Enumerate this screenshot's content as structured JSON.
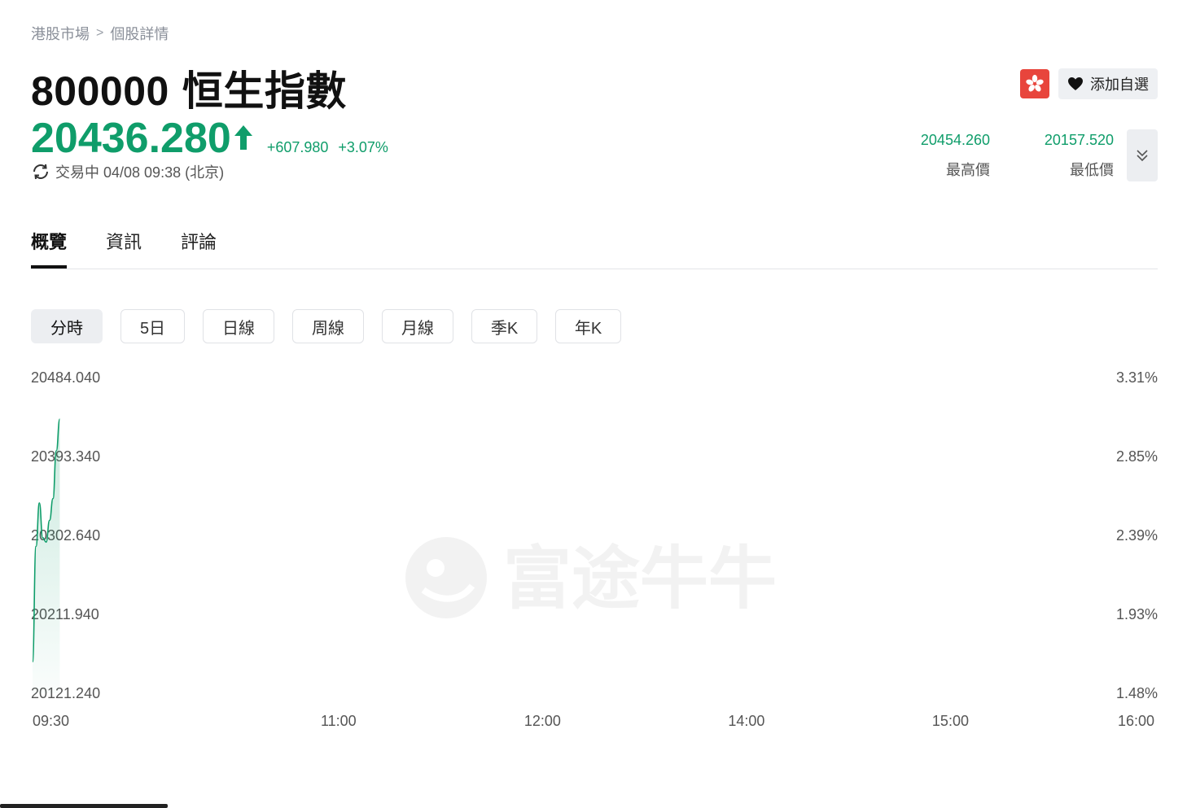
{
  "breadcrumb": {
    "market": "港股市場",
    "detail": "個股詳情"
  },
  "stock": {
    "code": "800000",
    "name": "恒生指數"
  },
  "quote": {
    "price": "20436.280",
    "change": "+607.980",
    "change_pct": "+3.07%",
    "status": "交易中 04/08 09:38 (北京)",
    "direction": "up"
  },
  "actions": {
    "watchlist_label": "添加自選",
    "flag_icon": "hong-kong-flag-icon"
  },
  "stats": [
    {
      "value": "20454.260",
      "label": "最高價"
    },
    {
      "value": "20157.520",
      "label": "最低價"
    }
  ],
  "tabs": [
    {
      "label": "概覽",
      "active": true
    },
    {
      "label": "資訊",
      "active": false
    },
    {
      "label": "評論",
      "active": false
    }
  ],
  "periods": [
    {
      "label": "分時",
      "active": true
    },
    {
      "label": "5日",
      "active": false
    },
    {
      "label": "日線",
      "active": false
    },
    {
      "label": "周線",
      "active": false
    },
    {
      "label": "月線",
      "active": false
    },
    {
      "label": "季K",
      "active": false
    },
    {
      "label": "年K",
      "active": false
    }
  ],
  "watermark": "富途牛牛",
  "colors": {
    "up": "#0f9d6a",
    "accent_flag": "#e8453c"
  },
  "chart_data": {
    "type": "area",
    "y_left_ticks": [
      "20484.040",
      "20393.340",
      "20302.640",
      "20211.940",
      "20121.240"
    ],
    "y_right_ticks": [
      "3.31%",
      "2.85%",
      "2.39%",
      "1.93%",
      "1.48%"
    ],
    "x_ticks": [
      "09:30",
      "11:00",
      "12:00",
      "14:00",
      "15:00",
      "16:00"
    ],
    "ylim": [
      20121.24,
      20484.04
    ],
    "series": [
      {
        "x": [
          "09:30",
          "09:31",
          "09:32",
          "09:33",
          "09:34",
          "09:35",
          "09:36",
          "09:37",
          "09:38"
        ],
        "values": [
          20157.5,
          20290,
          20340,
          20300,
          20295,
          20320,
          20345,
          20400,
          20436.3
        ]
      }
    ]
  }
}
